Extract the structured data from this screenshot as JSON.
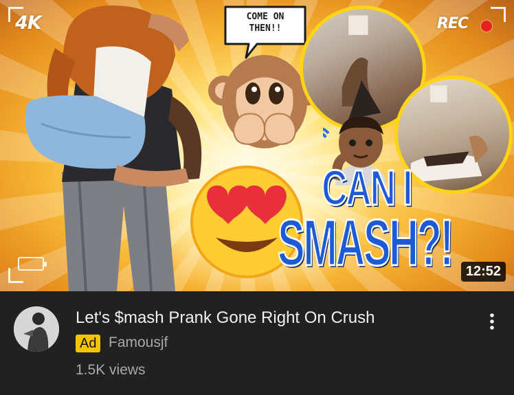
{
  "thumbnail": {
    "badge_4k": "4K",
    "rec_label": "REC",
    "speech_bubble": "COME ON\nTHEN!!",
    "title_line1": "CAN I",
    "title_line2": "SMASH?!",
    "duration": "12:52"
  },
  "video": {
    "title": "Let's $mash Prank Gone Right On Crush",
    "ad_label": "Ad",
    "channel": "Famousjf",
    "views": "1.5K views"
  },
  "icons": {
    "more": "more-vert-icon",
    "rec_indicator": "record-dot-icon",
    "battery": "battery-icon"
  },
  "colors": {
    "background": "#212121",
    "title_text": "#f1f1f1",
    "secondary_text": "#aaaaaa",
    "ad_badge": "#f5c400",
    "thumbnail_title": "#1c5ad6",
    "circle_border": "#ffd414",
    "rec_dot": "#e8211f"
  }
}
